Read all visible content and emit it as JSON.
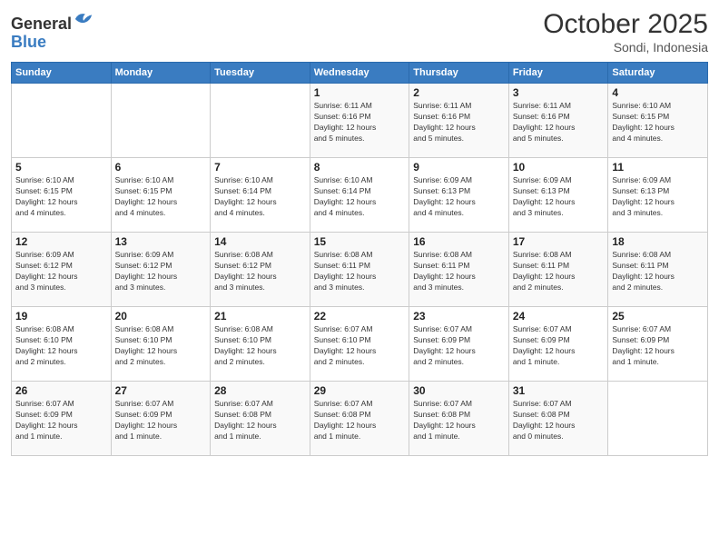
{
  "header": {
    "logo_general": "General",
    "logo_blue": "Blue",
    "month": "October 2025",
    "location": "Sondi, Indonesia"
  },
  "weekdays": [
    "Sunday",
    "Monday",
    "Tuesday",
    "Wednesday",
    "Thursday",
    "Friday",
    "Saturday"
  ],
  "weeks": [
    [
      {
        "day": "",
        "info": ""
      },
      {
        "day": "",
        "info": ""
      },
      {
        "day": "",
        "info": ""
      },
      {
        "day": "1",
        "info": "Sunrise: 6:11 AM\nSunset: 6:16 PM\nDaylight: 12 hours\nand 5 minutes."
      },
      {
        "day": "2",
        "info": "Sunrise: 6:11 AM\nSunset: 6:16 PM\nDaylight: 12 hours\nand 5 minutes."
      },
      {
        "day": "3",
        "info": "Sunrise: 6:11 AM\nSunset: 6:16 PM\nDaylight: 12 hours\nand 5 minutes."
      },
      {
        "day": "4",
        "info": "Sunrise: 6:10 AM\nSunset: 6:15 PM\nDaylight: 12 hours\nand 4 minutes."
      }
    ],
    [
      {
        "day": "5",
        "info": "Sunrise: 6:10 AM\nSunset: 6:15 PM\nDaylight: 12 hours\nand 4 minutes."
      },
      {
        "day": "6",
        "info": "Sunrise: 6:10 AM\nSunset: 6:15 PM\nDaylight: 12 hours\nand 4 minutes."
      },
      {
        "day": "7",
        "info": "Sunrise: 6:10 AM\nSunset: 6:14 PM\nDaylight: 12 hours\nand 4 minutes."
      },
      {
        "day": "8",
        "info": "Sunrise: 6:10 AM\nSunset: 6:14 PM\nDaylight: 12 hours\nand 4 minutes."
      },
      {
        "day": "9",
        "info": "Sunrise: 6:09 AM\nSunset: 6:13 PM\nDaylight: 12 hours\nand 4 minutes."
      },
      {
        "day": "10",
        "info": "Sunrise: 6:09 AM\nSunset: 6:13 PM\nDaylight: 12 hours\nand 3 minutes."
      },
      {
        "day": "11",
        "info": "Sunrise: 6:09 AM\nSunset: 6:13 PM\nDaylight: 12 hours\nand 3 minutes."
      }
    ],
    [
      {
        "day": "12",
        "info": "Sunrise: 6:09 AM\nSunset: 6:12 PM\nDaylight: 12 hours\nand 3 minutes."
      },
      {
        "day": "13",
        "info": "Sunrise: 6:09 AM\nSunset: 6:12 PM\nDaylight: 12 hours\nand 3 minutes."
      },
      {
        "day": "14",
        "info": "Sunrise: 6:08 AM\nSunset: 6:12 PM\nDaylight: 12 hours\nand 3 minutes."
      },
      {
        "day": "15",
        "info": "Sunrise: 6:08 AM\nSunset: 6:11 PM\nDaylight: 12 hours\nand 3 minutes."
      },
      {
        "day": "16",
        "info": "Sunrise: 6:08 AM\nSunset: 6:11 PM\nDaylight: 12 hours\nand 3 minutes."
      },
      {
        "day": "17",
        "info": "Sunrise: 6:08 AM\nSunset: 6:11 PM\nDaylight: 12 hours\nand 2 minutes."
      },
      {
        "day": "18",
        "info": "Sunrise: 6:08 AM\nSunset: 6:11 PM\nDaylight: 12 hours\nand 2 minutes."
      }
    ],
    [
      {
        "day": "19",
        "info": "Sunrise: 6:08 AM\nSunset: 6:10 PM\nDaylight: 12 hours\nand 2 minutes."
      },
      {
        "day": "20",
        "info": "Sunrise: 6:08 AM\nSunset: 6:10 PM\nDaylight: 12 hours\nand 2 minutes."
      },
      {
        "day": "21",
        "info": "Sunrise: 6:08 AM\nSunset: 6:10 PM\nDaylight: 12 hours\nand 2 minutes."
      },
      {
        "day": "22",
        "info": "Sunrise: 6:07 AM\nSunset: 6:10 PM\nDaylight: 12 hours\nand 2 minutes."
      },
      {
        "day": "23",
        "info": "Sunrise: 6:07 AM\nSunset: 6:09 PM\nDaylight: 12 hours\nand 2 minutes."
      },
      {
        "day": "24",
        "info": "Sunrise: 6:07 AM\nSunset: 6:09 PM\nDaylight: 12 hours\nand 1 minute."
      },
      {
        "day": "25",
        "info": "Sunrise: 6:07 AM\nSunset: 6:09 PM\nDaylight: 12 hours\nand 1 minute."
      }
    ],
    [
      {
        "day": "26",
        "info": "Sunrise: 6:07 AM\nSunset: 6:09 PM\nDaylight: 12 hours\nand 1 minute."
      },
      {
        "day": "27",
        "info": "Sunrise: 6:07 AM\nSunset: 6:09 PM\nDaylight: 12 hours\nand 1 minute."
      },
      {
        "day": "28",
        "info": "Sunrise: 6:07 AM\nSunset: 6:08 PM\nDaylight: 12 hours\nand 1 minute."
      },
      {
        "day": "29",
        "info": "Sunrise: 6:07 AM\nSunset: 6:08 PM\nDaylight: 12 hours\nand 1 minute."
      },
      {
        "day": "30",
        "info": "Sunrise: 6:07 AM\nSunset: 6:08 PM\nDaylight: 12 hours\nand 1 minute."
      },
      {
        "day": "31",
        "info": "Sunrise: 6:07 AM\nSunset: 6:08 PM\nDaylight: 12 hours\nand 0 minutes."
      },
      {
        "day": "",
        "info": ""
      }
    ]
  ]
}
